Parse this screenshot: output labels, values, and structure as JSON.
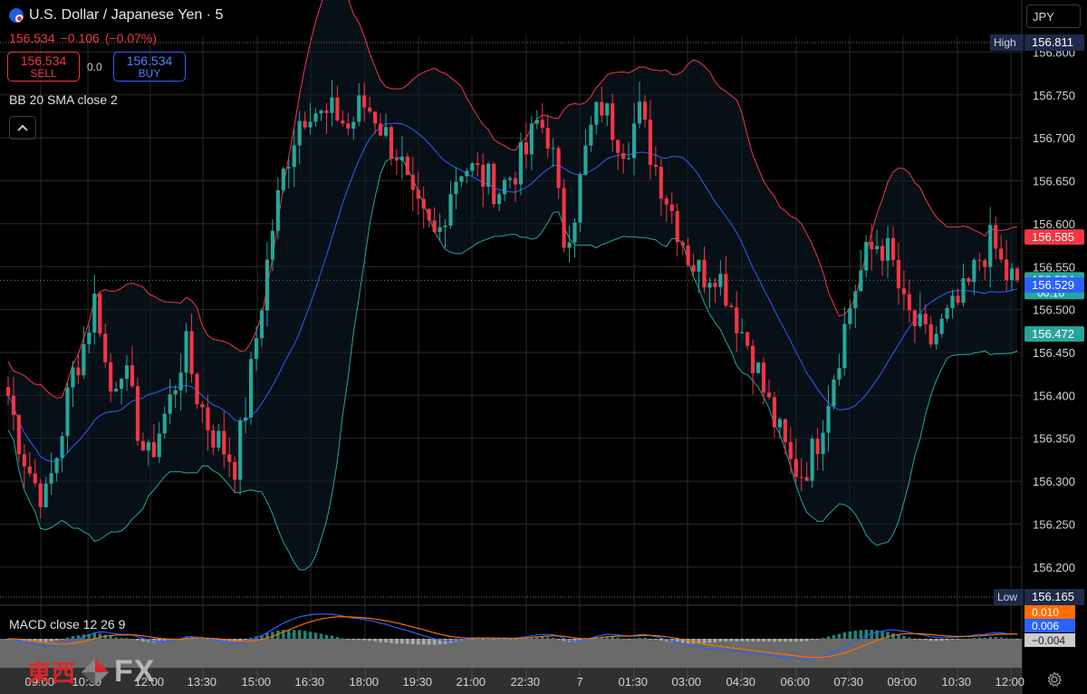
{
  "header": {
    "symbol": "U.S. Dollar / Japanese Yen · 5",
    "last": "156.534",
    "change": "−0.106",
    "change_pct": "(−0.07%)"
  },
  "trade": {
    "sell_price": "156.534",
    "sell_label": "SELL",
    "buy_price": "156.534",
    "buy_label": "BUY",
    "spread": "0.0"
  },
  "indicators": {
    "bb_label": "BB 20 SMA close 2",
    "macd_label": "MACD close 12 26 9"
  },
  "currency": "JPY",
  "logo": {
    "cn": "東西",
    "fx": "FX"
  },
  "colors": {
    "up": "#26a69a",
    "down": "#f23645",
    "basis": "#2962ff",
    "upper": "#f23645",
    "lower": "#26a69a",
    "macd": "#2962ff",
    "signal": "#ff6d00",
    "grid": "#2a2a2a"
  },
  "chart_data": {
    "type": "candlestick",
    "x_ticks": [
      "09:00",
      "10:30",
      "12:00",
      "13:30",
      "15:00",
      "16:30",
      "18:00",
      "19:30",
      "21:00",
      "22:30",
      "7",
      "01:30",
      "03:00",
      "04:30",
      "06:00",
      "07:30",
      "09:00",
      "10:30",
      "12:00"
    ],
    "y_ticks": [
      "156.800",
      "156.750",
      "156.700",
      "156.650",
      "156.600",
      "156.550",
      "156.500",
      "156.450",
      "156.400",
      "156.350",
      "156.300",
      "156.250",
      "156.200"
    ],
    "ylim": [
      156.165,
      156.811
    ],
    "high": {
      "label": "High",
      "value": "156.811"
    },
    "low": {
      "label": "Low",
      "value": "156.165"
    },
    "price_tags": [
      {
        "value": "156.585",
        "text": "156.585",
        "color": "#f23645"
      },
      {
        "value": "156.534",
        "text": "156.534",
        "sub": "00:10",
        "color": "#26a69a"
      },
      {
        "value": "156.529",
        "text": "156.529",
        "color": "#2962ff"
      },
      {
        "value": "156.472",
        "text": "156.472",
        "color": "#26a69a"
      }
    ],
    "close_path": [
      156.4,
      156.34,
      156.3,
      156.28,
      156.34,
      156.42,
      156.46,
      156.52,
      156.4,
      156.44,
      156.38,
      156.32,
      156.36,
      156.4,
      156.46,
      156.4,
      156.36,
      156.34,
      156.32,
      156.4,
      156.5,
      156.6,
      156.67,
      156.72,
      156.74,
      156.72,
      156.73,
      156.71,
      156.74,
      156.73,
      156.7,
      156.68,
      156.62,
      156.6,
      156.58,
      156.64,
      156.67,
      156.66,
      156.65,
      156.64,
      156.66,
      156.68,
      156.72,
      156.7,
      156.58,
      156.62,
      156.7,
      156.74,
      156.71,
      156.69,
      156.73,
      156.68,
      156.64,
      156.6,
      156.56,
      156.54,
      156.55,
      156.52,
      156.48,
      156.45,
      156.4,
      156.36,
      156.32,
      156.31,
      156.34,
      156.4,
      156.46,
      156.52,
      156.56,
      156.58,
      156.56,
      156.5,
      156.48,
      156.46,
      156.48,
      156.5,
      156.52,
      156.56,
      156.58,
      156.54,
      156.534
    ],
    "macd": {
      "macd_tags": [
        {
          "text": "0.010",
          "color": "#ff6d00"
        },
        {
          "text": "0.006",
          "color": "#2962ff"
        },
        {
          "text": "−0.004",
          "color": "#cccccc"
        }
      ]
    }
  }
}
